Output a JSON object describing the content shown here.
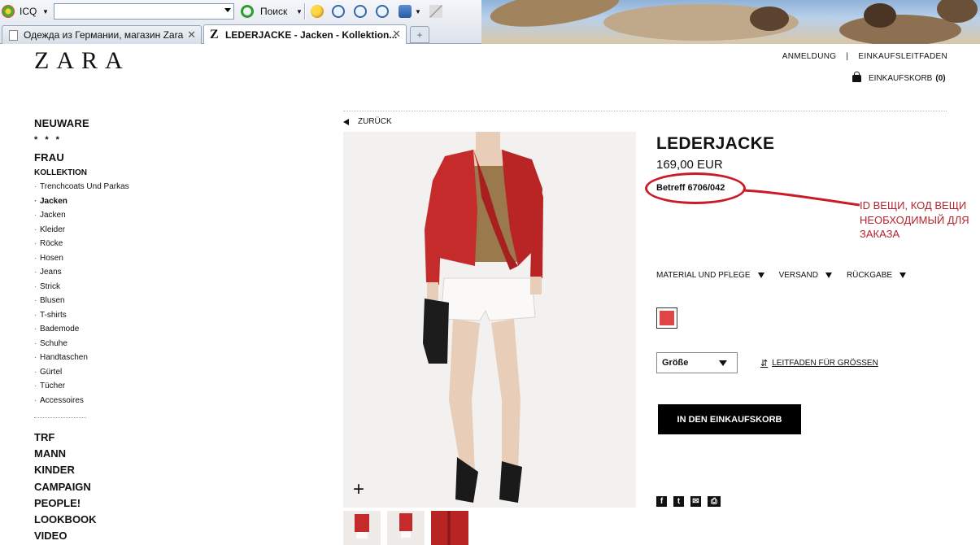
{
  "browser": {
    "icq_label": "ICQ",
    "search_value": "",
    "search_button": "Поиск",
    "tabs": [
      {
        "label": "Одежда из Германии, магазин Zara",
        "active": false
      },
      {
        "label": "LEDERJACKE - Jacken - Kollektion...",
        "active": true
      }
    ],
    "new_tab_symbol": "+"
  },
  "header": {
    "logo": "ZARA",
    "links": [
      "ANMELDUNG",
      "EINKAUFSLEITFADEN"
    ],
    "separator": "|",
    "cart_label": "EINKAUFSKORB",
    "cart_count": "(0)"
  },
  "sidebar": {
    "neuware": "NEUWARE",
    "stars": "* * *",
    "frau": "FRAU",
    "kollektion": "KOLLEKTION",
    "sub_items": [
      {
        "label": "Trenchcoats Und Parkas",
        "active": false
      },
      {
        "label": "Jacken",
        "active": true
      },
      {
        "label": "Jacken",
        "active": false
      },
      {
        "label": "Kleider",
        "active": false
      },
      {
        "label": "Röcke",
        "active": false
      },
      {
        "label": "Hosen",
        "active": false
      },
      {
        "label": "Jeans",
        "active": false
      },
      {
        "label": "Strick",
        "active": false
      },
      {
        "label": "Blusen",
        "active": false
      },
      {
        "label": "T-shirts",
        "active": false
      },
      {
        "label": "Bademode",
        "active": false
      },
      {
        "label": "Schuhe",
        "active": false
      },
      {
        "label": "Handtaschen",
        "active": false
      },
      {
        "label": "Gürtel",
        "active": false
      },
      {
        "label": "Tücher",
        "active": false
      },
      {
        "label": "Accessoires",
        "active": false
      }
    ],
    "main_items": [
      "TRF",
      "MANN",
      "KINDER",
      "CAMPAIGN",
      "PEOPLE!",
      "LOOKBOOK",
      "VIDEO"
    ]
  },
  "product": {
    "back_label": "ZURÜCK",
    "zoom_symbol": "+",
    "title": "LEDERJACKE",
    "price": "169,00 EUR",
    "reference": "Betreff 6706/042",
    "annotation_note": "ID ВЕЩИ, КОД ВЕЩИ НЕОБХОДИМЫЙ ДЛЯ ЗАКАЗА",
    "info_tabs": [
      "MATERIAL UND PFLEGE",
      "VERSAND",
      "RÜCKGABE"
    ],
    "color_swatch": "#e04545",
    "size_label": "Größe",
    "size_guide": "LEITFADEN FÜR GRÖSSEN",
    "add_to_cart": "IN DEN EINKAUFSKORB",
    "share_icons": [
      "facebook-icon",
      "twitter-icon",
      "email-icon",
      "print-icon"
    ]
  },
  "colors": {
    "jacket_red": "#c62b2b",
    "annotation_red": "#c81d28",
    "note_text": "#b5242c"
  }
}
